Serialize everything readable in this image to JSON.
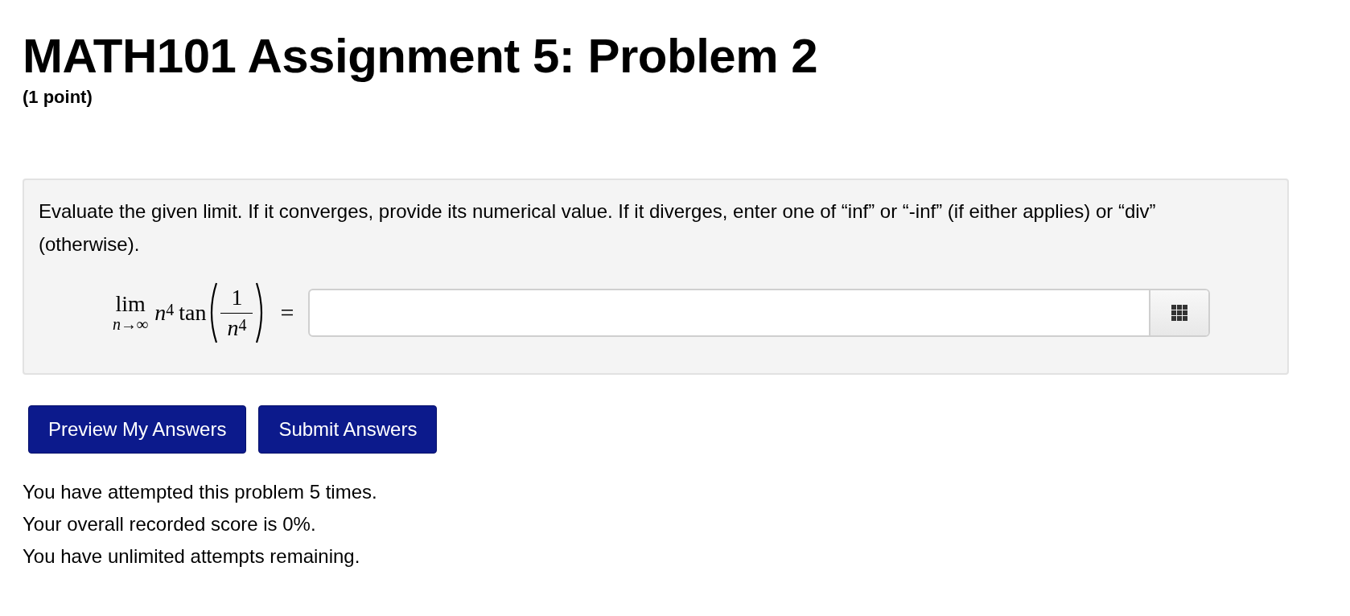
{
  "title": "MATH101 Assignment 5: Problem 2",
  "points": "(1 point)",
  "problem": {
    "statement": "Evaluate the given limit. If it converges, provide its numerical value. If it diverges, enter one of “inf” or “-inf” (if either applies) or “div” (otherwise).",
    "formula": {
      "operator": "lim",
      "subscript": "n→∞",
      "base": "n",
      "exponent": "4",
      "function": "tan",
      "numerator": "1",
      "denominator_base": "n",
      "denominator_exponent": "4",
      "relation": "="
    }
  },
  "buttons": [
    "Preview My Answers",
    "Submit Answers"
  ],
  "status_lines": [
    "You have attempted this problem 5 times.",
    "Your overall recorded score is 0%.",
    "You have unlimited attempts remaining."
  ]
}
